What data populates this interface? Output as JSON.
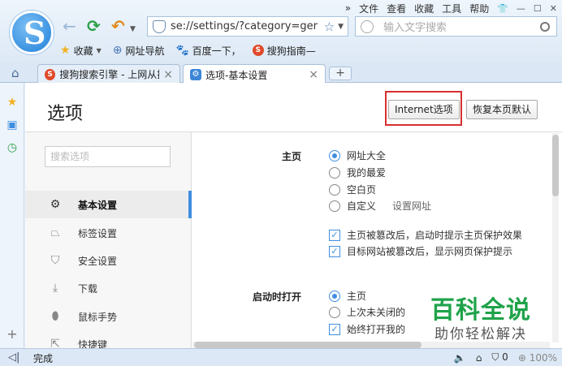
{
  "menubar": {
    "items": [
      "文件",
      "查看",
      "收藏",
      "工具",
      "帮助"
    ],
    "more": "»"
  },
  "address": {
    "url": "se://settings/?category=ger"
  },
  "search": {
    "placeholder": "输入文字搜索"
  },
  "bookmarks": [
    {
      "label": "收藏",
      "icon": "star-icon"
    },
    {
      "label": "网址导航",
      "icon": "globe-icon"
    },
    {
      "label": "百度一下，",
      "icon": "paw-icon"
    },
    {
      "label": "搜狗指南—",
      "icon": "sogou-icon"
    }
  ],
  "tabs": [
    {
      "label": "搜狗搜索引擎 - 上网从搜",
      "icon": "sogou-icon",
      "active": false
    },
    {
      "label": "选项-基本设置",
      "icon": "gear-icon",
      "active": true
    }
  ],
  "page": {
    "title": "选项",
    "internet_options_label": "Internet选项",
    "restore_default_label": "恢复本页默认"
  },
  "sidebar": {
    "search_placeholder": "搜索选项",
    "items": [
      {
        "label": "基本设置",
        "icon": "gear-icon",
        "active": true
      },
      {
        "label": "标签设置",
        "icon": "tab-icon",
        "active": false
      },
      {
        "label": "安全设置",
        "icon": "shield-icon",
        "active": false
      },
      {
        "label": "下载",
        "icon": "download-icon",
        "active": false
      },
      {
        "label": "鼠标手势",
        "icon": "mouse-icon",
        "active": false
      },
      {
        "label": "快捷键",
        "icon": "shortcut-icon",
        "active": false
      }
    ]
  },
  "homepage": {
    "label": "主页",
    "options": [
      {
        "label": "网址大全",
        "selected": true
      },
      {
        "label": "我的最爱",
        "selected": false
      },
      {
        "label": "空白页",
        "selected": false
      },
      {
        "label": "自定义",
        "selected": false
      }
    ],
    "set_url_link": "设置网址",
    "checks": [
      {
        "label": "主页被篡改后，启动时提示主页保护效果",
        "checked": true
      },
      {
        "label": "目标网站被篡改后，显示网页保护提示",
        "checked": true
      }
    ]
  },
  "startup": {
    "label": "启动时打开",
    "options": [
      {
        "label": "主页",
        "selected": true
      },
      {
        "label": "上次未关闭的",
        "selected": false
      }
    ],
    "check": {
      "label": "始终打开我的",
      "checked": true
    }
  },
  "watermark": {
    "line1": "百科全说",
    "line2": "助你轻松解决"
  },
  "status": {
    "text": "完成",
    "counter": "0",
    "zoom": "100%"
  },
  "colors": {
    "accent": "#3f8ee0",
    "highlight": "#d63030",
    "watermark_green": "#1fa34a"
  }
}
